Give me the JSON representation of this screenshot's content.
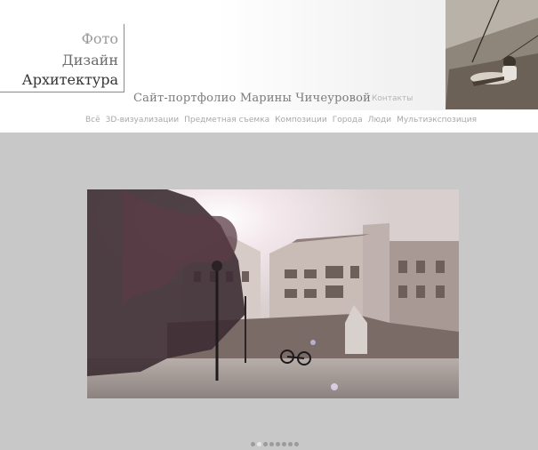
{
  "logo": {
    "line1": "Фото",
    "line2": "Дизайн",
    "line3": "Архитектура"
  },
  "header": {
    "site_title": "Сайт-портфолио  Марины Чичеуровой",
    "contacts_label": "Контакты"
  },
  "nav": {
    "items": [
      "Всё",
      "3D-визуализации",
      "Предметная съемка",
      "Композиции",
      "Города",
      "Люди",
      "Мультиэкспозиция"
    ]
  },
  "slideshow": {
    "dot_count": 8,
    "active_index": 1
  },
  "colors": {
    "page_background": "#c8c8c8",
    "header_background": "#ffffff",
    "nav_text": "#a8a8a8",
    "title_text": "#7a7a7a"
  }
}
